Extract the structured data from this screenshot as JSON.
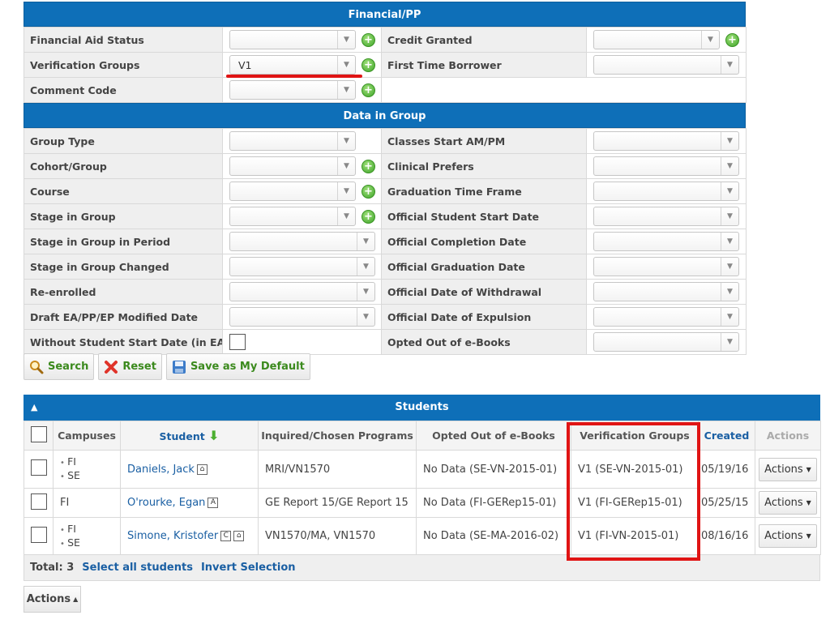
{
  "financial": {
    "header": "Financial/PP",
    "rows": [
      {
        "left_label": "Financial Aid Status",
        "left_value": "",
        "right_label": "Credit Granted",
        "right_value": ""
      },
      {
        "left_label": "Verification Groups",
        "left_value": "V1",
        "right_label": "First Time Borrower",
        "right_value": ""
      },
      {
        "left_label": "Comment Code",
        "left_value": "",
        "right_label": "",
        "right_value": ""
      }
    ]
  },
  "group": {
    "header": "Data in Group",
    "rows": [
      {
        "left_label": "Group Type",
        "right_label": "Classes Start AM/PM"
      },
      {
        "left_label": "Cohort/Group",
        "right_label": "Clinical Prefers"
      },
      {
        "left_label": "Course",
        "right_label": "Graduation Time Frame"
      },
      {
        "left_label": "Stage in Group",
        "right_label": "Official Student Start Date"
      },
      {
        "left_label": "Stage in Group in Period",
        "right_label": "Official Completion Date"
      },
      {
        "left_label": "Stage in Group Changed",
        "right_label": "Official Graduation Date"
      },
      {
        "left_label": "Re-enrolled",
        "right_label": "Official Date of Withdrawal"
      },
      {
        "left_label": "Draft EA/PP/EP Modified Date",
        "right_label": "Official Date of Expulsion"
      },
      {
        "left_label": "Without Student Start Date (in EA)",
        "right_label": "Opted Out of e-Books"
      }
    ]
  },
  "toolbar": {
    "search": "Search",
    "reset": "Reset",
    "save_default": "Save as My Default"
  },
  "students": {
    "header": "Students",
    "columns": {
      "campuses": "Campuses",
      "student": "Student",
      "programs": "Inquired/Chosen Programs",
      "ebooks": "Opted Out of e-Books",
      "verification": "Verification Groups",
      "created": "Created",
      "actions": "Actions"
    },
    "rows": [
      {
        "campuses": [
          "FI",
          "SE"
        ],
        "name": "Daniels, Jack",
        "badges": [
          "⌂"
        ],
        "programs": "MRI/VN1570",
        "ebooks": "No Data (SE-VN-2015-01)",
        "verification": "V1 (SE-VN-2015-01)",
        "created": "05/19/16",
        "action": "Actions"
      },
      {
        "campuses": [
          "FI"
        ],
        "name": "O'rourke, Egan",
        "badges": [
          "A"
        ],
        "programs": "GE Report 15/GE Report 15",
        "ebooks": "No Data (FI-GERep15-01)",
        "verification": "V1 (FI-GERep15-01)",
        "created": "05/25/15",
        "action": "Actions"
      },
      {
        "campuses": [
          "FI",
          "SE"
        ],
        "name": "Simone, Kristofer",
        "badges": [
          "C",
          "⌂"
        ],
        "programs": "VN1570/MA, VN1570",
        "ebooks": "No Data (SE-MA-2016-02)",
        "verification": "V1 (FI-VN-2015-01)",
        "created": "08/16/16",
        "action": "Actions"
      }
    ],
    "total_label": "Total: 3",
    "select_all": "Select all students",
    "invert": "Invert Selection",
    "bottom_actions": "Actions"
  },
  "colors": {
    "header_blue": "#0e6fb8",
    "highlight_red": "#e01414",
    "link": "#1a5fa3",
    "green": "#3b8a1d"
  }
}
